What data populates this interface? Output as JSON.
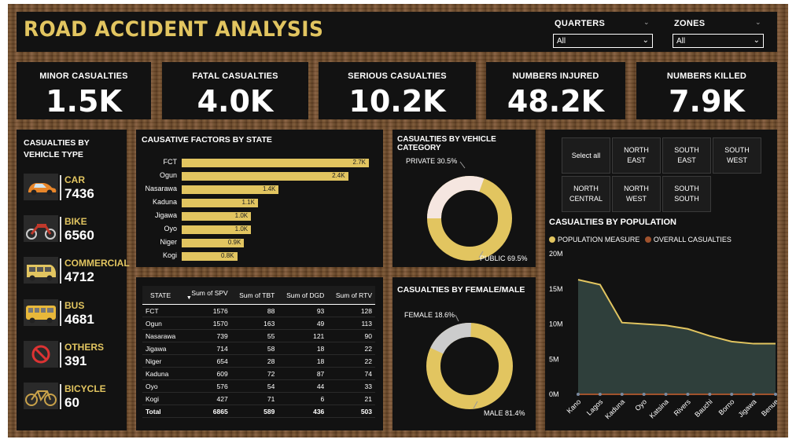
{
  "header": {
    "title": "ROAD ACCIDENT ANALYSIS",
    "quarters_label": "QUARTERS",
    "quarters_value": "All",
    "zones_label": "ZONES",
    "zones_value": "All"
  },
  "kpis": [
    {
      "label": "MINOR CASUALTIES",
      "value": "1.5K"
    },
    {
      "label": "FATAL CASUALTIES",
      "value": "4.0K"
    },
    {
      "label": "SERIOUS CASUALTIES",
      "value": "10.2K"
    },
    {
      "label": "NUMBERS INJURED",
      "value": "48.2K"
    },
    {
      "label": "NUMBERS KILLED",
      "value": "7.9K"
    }
  ],
  "vehicle_type": {
    "title": "CASUALTIES BY VEHICLE TYPE",
    "items": [
      {
        "name": "CAR",
        "value": "7436",
        "icon": "car-icon"
      },
      {
        "name": "BIKE",
        "value": "6560",
        "icon": "motorbike-icon"
      },
      {
        "name": "COMMERCIAL",
        "value": "4712",
        "icon": "van-icon"
      },
      {
        "name": "BUS",
        "value": "4681",
        "icon": "bus-icon"
      },
      {
        "name": "OTHERS",
        "value": "391",
        "icon": "no-entry-icon"
      },
      {
        "name": "BICYCLE",
        "value": "60",
        "icon": "bicycle-icon"
      }
    ]
  },
  "causative": {
    "title": "CAUSATIVE FACTORS BY STATE",
    "rows": [
      {
        "state": "FCT",
        "value": 2700,
        "label": "2.7K"
      },
      {
        "state": "Ogun",
        "value": 2400,
        "label": "2.4K"
      },
      {
        "state": "Nasarawa",
        "value": 1400,
        "label": "1.4K"
      },
      {
        "state": "Kaduna",
        "value": 1100,
        "label": "1.1K"
      },
      {
        "state": "Jigawa",
        "value": 1000,
        "label": "1.0K"
      },
      {
        "state": "Oyo",
        "value": 1000,
        "label": "1.0K"
      },
      {
        "state": "Niger",
        "value": 900,
        "label": "0.9K"
      },
      {
        "state": "Kogi",
        "value": 800,
        "label": "0.8K"
      }
    ]
  },
  "table": {
    "headers": [
      "STATE",
      "Sum of SPV",
      "Sum of TBT",
      "Sum of DGD",
      "Sum of RTV"
    ],
    "rows": [
      [
        "FCT",
        "1576",
        "88",
        "93",
        "128"
      ],
      [
        "Ogun",
        "1570",
        "163",
        "49",
        "113"
      ],
      [
        "Nasarawa",
        "739",
        "55",
        "121",
        "90"
      ],
      [
        "Jigawa",
        "714",
        "58",
        "18",
        "22"
      ],
      [
        "Niger",
        "654",
        "28",
        "18",
        "22"
      ],
      [
        "Kaduna",
        "609",
        "72",
        "87",
        "74"
      ],
      [
        "Oyo",
        "576",
        "54",
        "44",
        "33"
      ],
      [
        "Kogi",
        "427",
        "71",
        "6",
        "21"
      ]
    ],
    "total": [
      "Total",
      "6865",
      "589",
      "436",
      "503"
    ]
  },
  "vehicle_category": {
    "title": "CASUALTIES BY VEHICLE CATEGORY",
    "private_label": "PRIVATE 30.5%",
    "public_label": "PUBLIC 69.5%",
    "private_pct": 30.5,
    "public_pct": 69.5
  },
  "gender": {
    "title": "CASUALTIES BY FEMALE/MALE",
    "female_label": "FEMALE 18.6%",
    "male_label": "MALE 81.4%",
    "female_pct": 18.6,
    "male_pct": 81.4
  },
  "zones": {
    "buttons": [
      {
        "line1": "Select all",
        "line2": ""
      },
      {
        "line1": "NORTH",
        "line2": "EAST"
      },
      {
        "line1": "SOUTH",
        "line2": "EAST"
      },
      {
        "line1": "SOUTH",
        "line2": "WEST"
      },
      {
        "line1": "NORTH",
        "line2": "CENTRAL"
      },
      {
        "line1": "NORTH",
        "line2": "WEST"
      },
      {
        "line1": "SOUTH",
        "line2": "SOUTH"
      }
    ]
  },
  "population": {
    "title": "CASUALTIES BY POPULATION",
    "legend1": "POPULATION MEASURE",
    "legend2": "OVERALL CASUALTIES",
    "color1": "#e2c560",
    "color2": "#a0522d"
  },
  "colors": {
    "accent": "#e2c560",
    "ring_light": "#f5e6e0",
    "ring_gray": "#cccccc",
    "area_fill": "#2f3f3b"
  },
  "chart_data": {
    "type": "area",
    "title": "CASUALTIES BY POPULATION",
    "categories": [
      "Kano",
      "Lagos",
      "Kaduna",
      "Oyo",
      "Katsina",
      "Rivers",
      "Bauchi",
      "Borno",
      "Jigawa",
      "Benue"
    ],
    "series": [
      {
        "name": "POPULATION MEASURE",
        "values": [
          16.3,
          15.6,
          10.2,
          10.0,
          9.8,
          9.3,
          8.3,
          7.5,
          7.2,
          7.2
        ]
      },
      {
        "name": "OVERALL CASUALTIES",
        "values": [
          0.0,
          0.0,
          0.0,
          0.0,
          0.0,
          0.0,
          0.0,
          0.0,
          0.0,
          0.0
        ]
      }
    ],
    "yticks": [
      "20M",
      "15M",
      "10M",
      "5M",
      "0M"
    ],
    "ylim": [
      0,
      20
    ],
    "legend": "top-left"
  }
}
